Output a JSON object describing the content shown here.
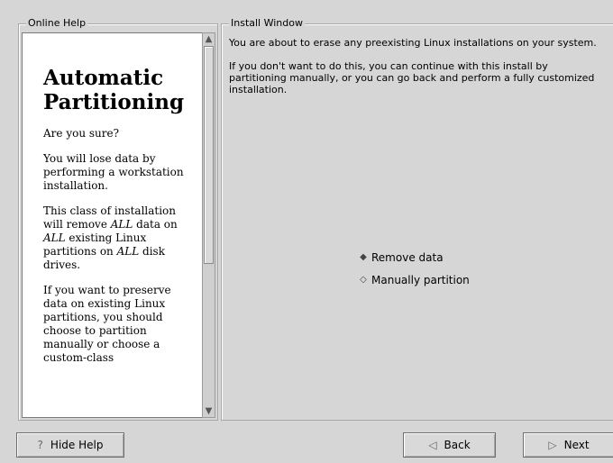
{
  "online_help": {
    "legend": "Online Help",
    "title": "Automatic Partitioning",
    "paragraphs": [
      "Are you sure?",
      "You will lose data by performing a workstation installation.",
      "This class of installation will remove ALL data on ALL existing Linux partitions on ALL disk drives.",
      "If you want to preserve data on existing Linux partitions, you should choose to partition manually or choose a custom-class"
    ]
  },
  "install_window": {
    "legend": "Install Window",
    "text1": "You are about to erase any preexisting Linux installations on your system.",
    "text2": "If you don't want to do this, you can continue with this install by partitioning manually, or you can go back and perform a fully customized installation.",
    "options": [
      {
        "label": "Remove data",
        "selected": true
      },
      {
        "label": "Manually partition",
        "selected": false
      }
    ]
  },
  "buttons": {
    "hide_help": "Hide Help",
    "back": "Back",
    "next": "Next"
  },
  "icons": {
    "help": "question-icon",
    "back": "left-triangle-icon",
    "next": "right-triangle-icon"
  }
}
